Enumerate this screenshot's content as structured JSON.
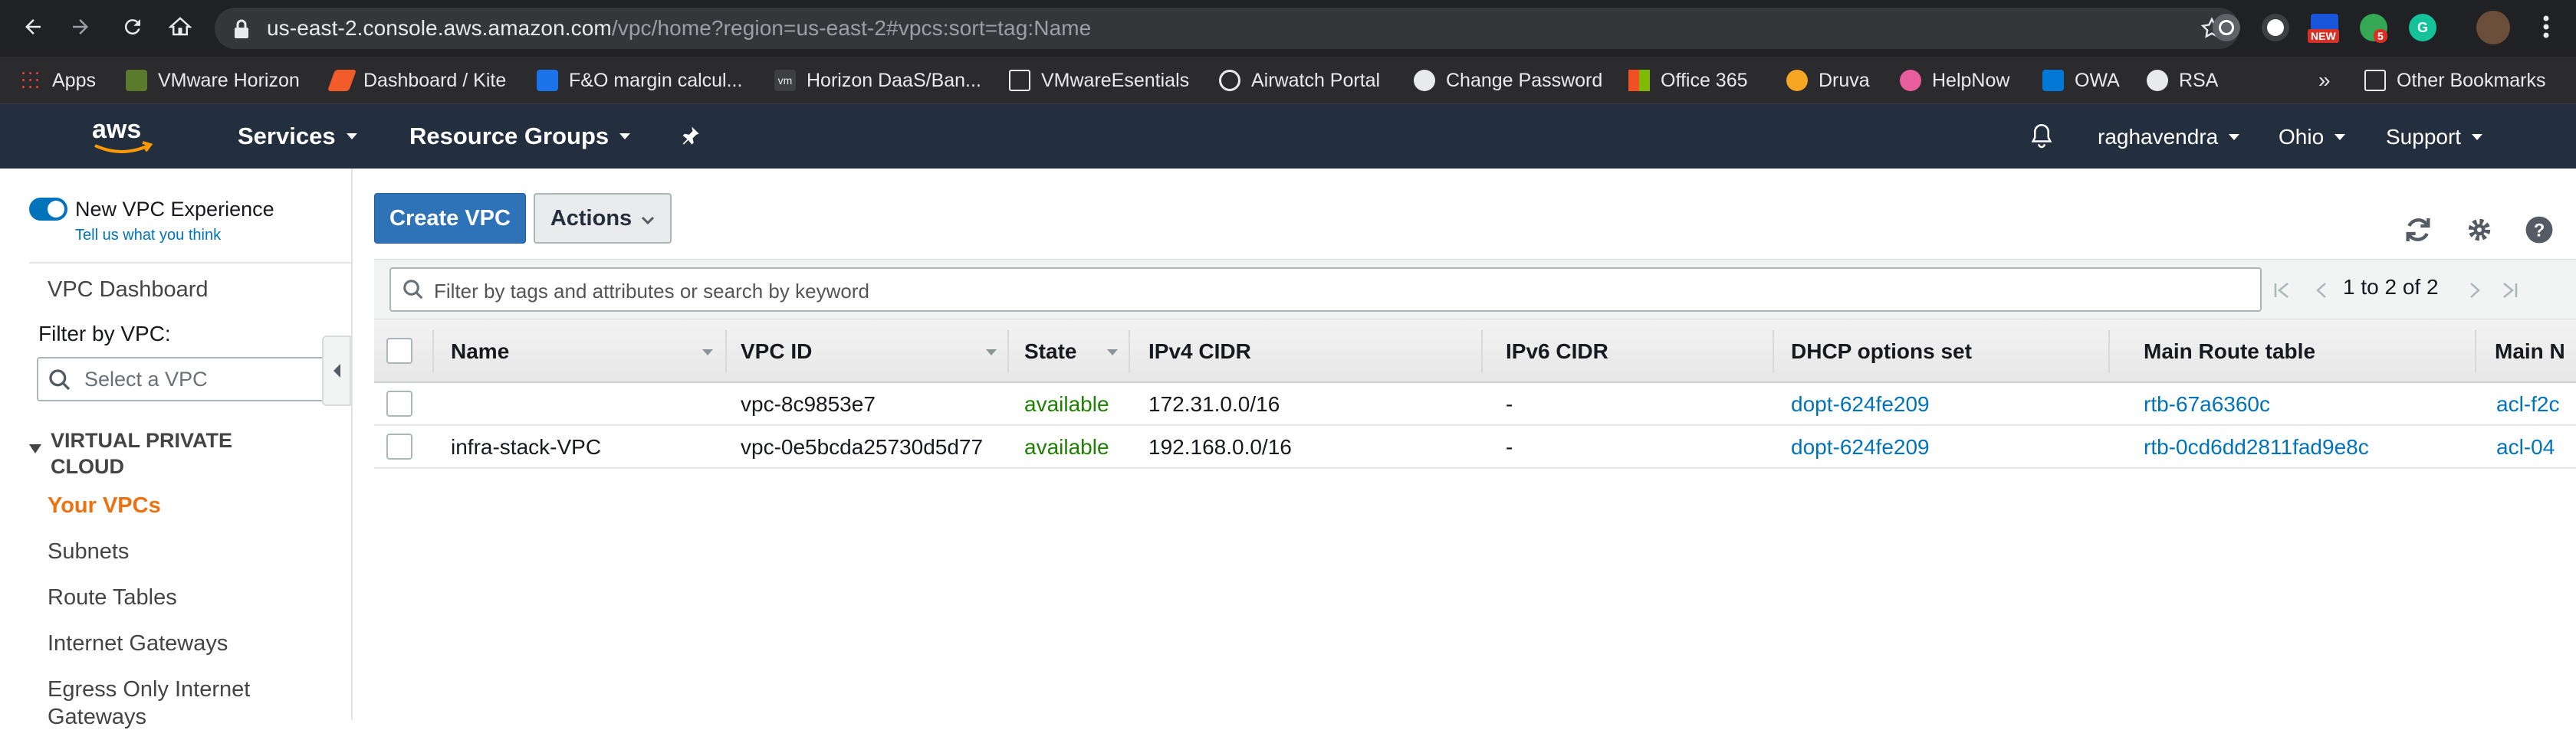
{
  "browser": {
    "url_host": "us-east-2.console.aws.amazon.com",
    "url_path": "/vpc/home?region=us-east-2#vpcs:sort=tag:Name",
    "ext_badges": [
      "NEW",
      "5"
    ],
    "bookmarks": [
      "Apps",
      "VMware Horizon",
      "Dashboard / Kite",
      "F&O margin calcul...",
      "Horizon DaaS/Ban...",
      "VMwareEsentials",
      "Airwatch Portal",
      "Change Password",
      "Office 365",
      "Druva",
      "HelpNow",
      "OWA",
      "RSA"
    ],
    "bookmarks_overflow": "»",
    "other_bookmarks": "Other Bookmarks"
  },
  "aws_header": {
    "services": "Services",
    "resource_groups": "Resource Groups",
    "user": "raghavendra",
    "region": "Ohio",
    "support": "Support"
  },
  "sidebar": {
    "toggle_label": "New VPC Experience",
    "feedback_link": "Tell us what you think",
    "dashboard": "VPC Dashboard",
    "filter_label": "Filter by VPC:",
    "filter_placeholder": "Select a VPC",
    "section_title_1": "VIRTUAL PRIVATE",
    "section_title_2": "CLOUD",
    "items": [
      "Your VPCs",
      "Subnets",
      "Route Tables",
      "Internet Gateways",
      "Egress Only Internet",
      "Gateways"
    ]
  },
  "toolbar": {
    "create_vpc": "Create VPC",
    "actions": "Actions"
  },
  "table": {
    "search_placeholder": "Filter by tags and attributes or search by keyword",
    "pagination": "1 to 2 of 2",
    "columns": [
      "Name",
      "VPC ID",
      "State",
      "IPv4 CIDR",
      "IPv6 CIDR",
      "DHCP options set",
      "Main Route table",
      "Main N"
    ],
    "rows": [
      {
        "name": "",
        "vpc_id": "vpc-8c9853e7",
        "state": "available",
        "ipv4": "172.31.0.0/16",
        "ipv6": "-",
        "dhcp": "dopt-624fe209",
        "route_table": "rtb-67a6360c",
        "acl": "acl-f2c"
      },
      {
        "name": "infra-stack-VPC",
        "vpc_id": "vpc-0e5bcda25730d5d77",
        "state": "available",
        "ipv4": "192.168.0.0/16",
        "ipv6": "-",
        "dhcp": "dopt-624fe209",
        "route_table": "rtb-0cd6dd2811fad9e8c",
        "acl": "acl-04"
      }
    ]
  },
  "colors": {
    "aws_header": "#232f3e",
    "primary_button": "#2e73b8",
    "link": "#0073bb",
    "available": "#1d8102",
    "active_nav": "#ec7211"
  }
}
